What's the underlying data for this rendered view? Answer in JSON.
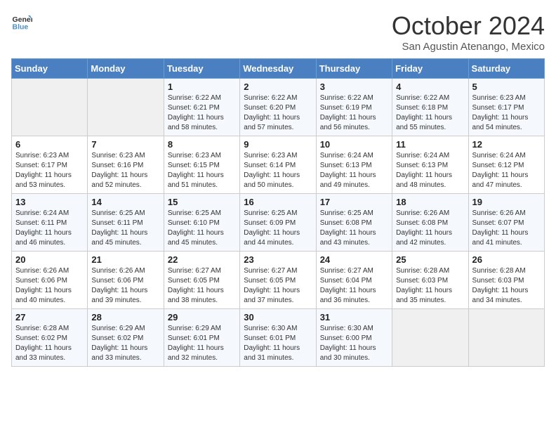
{
  "logo": {
    "line1": "General",
    "line2": "Blue"
  },
  "title": "October 2024",
  "subtitle": "San Agustin Atenango, Mexico",
  "days_of_week": [
    "Sunday",
    "Monday",
    "Tuesday",
    "Wednesday",
    "Thursday",
    "Friday",
    "Saturday"
  ],
  "weeks": [
    [
      {
        "day": "",
        "empty": true
      },
      {
        "day": "",
        "empty": true
      },
      {
        "day": "1",
        "sunrise": "Sunrise: 6:22 AM",
        "sunset": "Sunset: 6:21 PM",
        "daylight": "Daylight: 11 hours and 58 minutes."
      },
      {
        "day": "2",
        "sunrise": "Sunrise: 6:22 AM",
        "sunset": "Sunset: 6:20 PM",
        "daylight": "Daylight: 11 hours and 57 minutes."
      },
      {
        "day": "3",
        "sunrise": "Sunrise: 6:22 AM",
        "sunset": "Sunset: 6:19 PM",
        "daylight": "Daylight: 11 hours and 56 minutes."
      },
      {
        "day": "4",
        "sunrise": "Sunrise: 6:22 AM",
        "sunset": "Sunset: 6:18 PM",
        "daylight": "Daylight: 11 hours and 55 minutes."
      },
      {
        "day": "5",
        "sunrise": "Sunrise: 6:23 AM",
        "sunset": "Sunset: 6:17 PM",
        "daylight": "Daylight: 11 hours and 54 minutes."
      }
    ],
    [
      {
        "day": "6",
        "sunrise": "Sunrise: 6:23 AM",
        "sunset": "Sunset: 6:17 PM",
        "daylight": "Daylight: 11 hours and 53 minutes."
      },
      {
        "day": "7",
        "sunrise": "Sunrise: 6:23 AM",
        "sunset": "Sunset: 6:16 PM",
        "daylight": "Daylight: 11 hours and 52 minutes."
      },
      {
        "day": "8",
        "sunrise": "Sunrise: 6:23 AM",
        "sunset": "Sunset: 6:15 PM",
        "daylight": "Daylight: 11 hours and 51 minutes."
      },
      {
        "day": "9",
        "sunrise": "Sunrise: 6:23 AM",
        "sunset": "Sunset: 6:14 PM",
        "daylight": "Daylight: 11 hours and 50 minutes."
      },
      {
        "day": "10",
        "sunrise": "Sunrise: 6:24 AM",
        "sunset": "Sunset: 6:13 PM",
        "daylight": "Daylight: 11 hours and 49 minutes."
      },
      {
        "day": "11",
        "sunrise": "Sunrise: 6:24 AM",
        "sunset": "Sunset: 6:13 PM",
        "daylight": "Daylight: 11 hours and 48 minutes."
      },
      {
        "day": "12",
        "sunrise": "Sunrise: 6:24 AM",
        "sunset": "Sunset: 6:12 PM",
        "daylight": "Daylight: 11 hours and 47 minutes."
      }
    ],
    [
      {
        "day": "13",
        "sunrise": "Sunrise: 6:24 AM",
        "sunset": "Sunset: 6:11 PM",
        "daylight": "Daylight: 11 hours and 46 minutes."
      },
      {
        "day": "14",
        "sunrise": "Sunrise: 6:25 AM",
        "sunset": "Sunset: 6:11 PM",
        "daylight": "Daylight: 11 hours and 45 minutes."
      },
      {
        "day": "15",
        "sunrise": "Sunrise: 6:25 AM",
        "sunset": "Sunset: 6:10 PM",
        "daylight": "Daylight: 11 hours and 45 minutes."
      },
      {
        "day": "16",
        "sunrise": "Sunrise: 6:25 AM",
        "sunset": "Sunset: 6:09 PM",
        "daylight": "Daylight: 11 hours and 44 minutes."
      },
      {
        "day": "17",
        "sunrise": "Sunrise: 6:25 AM",
        "sunset": "Sunset: 6:08 PM",
        "daylight": "Daylight: 11 hours and 43 minutes."
      },
      {
        "day": "18",
        "sunrise": "Sunrise: 6:26 AM",
        "sunset": "Sunset: 6:08 PM",
        "daylight": "Daylight: 11 hours and 42 minutes."
      },
      {
        "day": "19",
        "sunrise": "Sunrise: 6:26 AM",
        "sunset": "Sunset: 6:07 PM",
        "daylight": "Daylight: 11 hours and 41 minutes."
      }
    ],
    [
      {
        "day": "20",
        "sunrise": "Sunrise: 6:26 AM",
        "sunset": "Sunset: 6:06 PM",
        "daylight": "Daylight: 11 hours and 40 minutes."
      },
      {
        "day": "21",
        "sunrise": "Sunrise: 6:26 AM",
        "sunset": "Sunset: 6:06 PM",
        "daylight": "Daylight: 11 hours and 39 minutes."
      },
      {
        "day": "22",
        "sunrise": "Sunrise: 6:27 AM",
        "sunset": "Sunset: 6:05 PM",
        "daylight": "Daylight: 11 hours and 38 minutes."
      },
      {
        "day": "23",
        "sunrise": "Sunrise: 6:27 AM",
        "sunset": "Sunset: 6:05 PM",
        "daylight": "Daylight: 11 hours and 37 minutes."
      },
      {
        "day": "24",
        "sunrise": "Sunrise: 6:27 AM",
        "sunset": "Sunset: 6:04 PM",
        "daylight": "Daylight: 11 hours and 36 minutes."
      },
      {
        "day": "25",
        "sunrise": "Sunrise: 6:28 AM",
        "sunset": "Sunset: 6:03 PM",
        "daylight": "Daylight: 11 hours and 35 minutes."
      },
      {
        "day": "26",
        "sunrise": "Sunrise: 6:28 AM",
        "sunset": "Sunset: 6:03 PM",
        "daylight": "Daylight: 11 hours and 34 minutes."
      }
    ],
    [
      {
        "day": "27",
        "sunrise": "Sunrise: 6:28 AM",
        "sunset": "Sunset: 6:02 PM",
        "daylight": "Daylight: 11 hours and 33 minutes."
      },
      {
        "day": "28",
        "sunrise": "Sunrise: 6:29 AM",
        "sunset": "Sunset: 6:02 PM",
        "daylight": "Daylight: 11 hours and 33 minutes."
      },
      {
        "day": "29",
        "sunrise": "Sunrise: 6:29 AM",
        "sunset": "Sunset: 6:01 PM",
        "daylight": "Daylight: 11 hours and 32 minutes."
      },
      {
        "day": "30",
        "sunrise": "Sunrise: 6:30 AM",
        "sunset": "Sunset: 6:01 PM",
        "daylight": "Daylight: 11 hours and 31 minutes."
      },
      {
        "day": "31",
        "sunrise": "Sunrise: 6:30 AM",
        "sunset": "Sunset: 6:00 PM",
        "daylight": "Daylight: 11 hours and 30 minutes."
      },
      {
        "day": "",
        "empty": true
      },
      {
        "day": "",
        "empty": true
      }
    ]
  ]
}
